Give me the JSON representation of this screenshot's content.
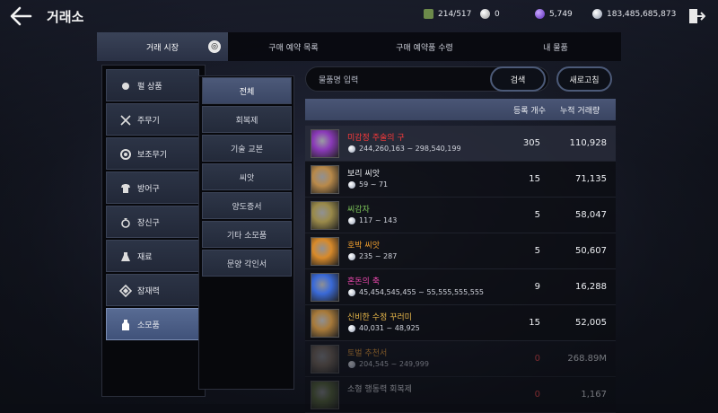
{
  "header": {
    "title": "거래소",
    "currencies": [
      {
        "icon": "bag-capacity-icon",
        "value": "214/517",
        "color": "#6c8a4a"
      },
      {
        "icon": "pearl-icon",
        "value": "0",
        "color": "#c9c9c9"
      },
      {
        "icon": "energy-icon",
        "value": "5,749",
        "color": "#7a4ad8"
      },
      {
        "icon": "silver-icon",
        "value": "183,485,685,873",
        "color": "#cfd6e0"
      }
    ]
  },
  "tabs": [
    {
      "label": "거래 시장",
      "active": true
    },
    {
      "label": "구매 예약 목록",
      "active": false
    },
    {
      "label": "구매 예약품 수령",
      "active": false
    },
    {
      "label": "내 물품",
      "active": false
    }
  ],
  "categories": [
    {
      "label": "펄 상품",
      "icon": "pearl-item-icon",
      "active": false
    },
    {
      "label": "주무기",
      "icon": "main-weapon-icon",
      "active": false
    },
    {
      "label": "보조무기",
      "icon": "sub-weapon-icon",
      "active": false
    },
    {
      "label": "방어구",
      "icon": "armor-icon",
      "active": false
    },
    {
      "label": "장신구",
      "icon": "accessory-icon",
      "active": false
    },
    {
      "label": "재료",
      "icon": "material-icon",
      "active": false
    },
    {
      "label": "잠재력",
      "icon": "potential-icon",
      "active": false
    },
    {
      "label": "소모품",
      "icon": "consumable-icon",
      "active": true
    }
  ],
  "subcategories": [
    {
      "label": "전체",
      "active": true
    },
    {
      "label": "회복제",
      "active": false
    },
    {
      "label": "기술 교본",
      "active": false
    },
    {
      "label": "씨앗",
      "active": false
    },
    {
      "label": "양도증서",
      "active": false
    },
    {
      "label": "기타 소모품",
      "active": false
    },
    {
      "label": "문양 각인서",
      "active": false
    }
  ],
  "search": {
    "placeholder": "물품명 입력",
    "search_label": "검색",
    "refresh_label": "새로고침"
  },
  "list": {
    "headers": {
      "count": "등록 개수",
      "total": "누적 거래량"
    },
    "items": [
      {
        "name": "미감정 주술의 구",
        "range": "244,260,163 ~ 298,540,199",
        "count": "305",
        "total": "110,928",
        "name_color": "#ff3a3a",
        "thumb_color": "#8a3ab8"
      },
      {
        "name": "보리 씨앗",
        "range": "59 ~ 71",
        "count": "15",
        "total": "71,135",
        "name_color": "#eef0f4",
        "thumb_color": "#b8894a"
      },
      {
        "name": "씨감자",
        "range": "117 ~ 143",
        "count": "5",
        "total": "58,047",
        "name_color": "#7ec85a",
        "thumb_color": "#9a8a4a"
      },
      {
        "name": "호박 씨앗",
        "range": "235 ~ 287",
        "count": "5",
        "total": "50,607",
        "name_color": "#f4a230",
        "thumb_color": "#d88a2a"
      },
      {
        "name": "혼돈의 축",
        "range": "45,454,545,455 ~ 55,555,555,555",
        "count": "9",
        "total": "16,288",
        "name_color": "#f04ab0",
        "thumb_color": "#3a6ad8"
      },
      {
        "name": "신비한 수정 꾸러미",
        "range": "40,031 ~ 48,925",
        "count": "15",
        "total": "52,005",
        "name_color": "#e8b84a",
        "thumb_color": "#a87a3a"
      },
      {
        "name": "토벌 추천서",
        "range": "204,545 ~ 249,999",
        "count": "0",
        "total": "268.89M",
        "name_color": "#f4a230",
        "thumb_color": "#7a6a5a"
      },
      {
        "name": "소형 행동력 회복제",
        "range": "",
        "count": "0",
        "total": "1,167",
        "name_color": "#eef0f4",
        "thumb_color": "#5a6a3a"
      }
    ]
  }
}
